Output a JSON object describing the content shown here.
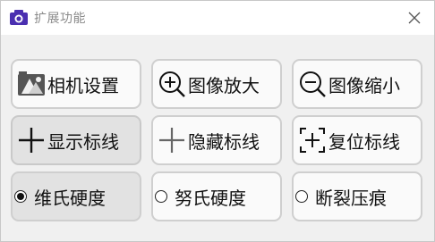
{
  "window": {
    "title": "扩展功能"
  },
  "buttons": {
    "camera_settings": "相机设置",
    "zoom_in": "图像放大",
    "zoom_out": "图像缩小",
    "show_marker": "显示标线",
    "hide_marker": "隐藏标线",
    "reset_marker": "复位标线"
  },
  "hardness_mode": {
    "options": [
      "维氏硬度",
      "努氏硬度",
      "断裂压痕"
    ],
    "selected": "维氏硬度"
  },
  "colors": {
    "app_icon": "#4a2fb0",
    "text": "#111111",
    "button_bg": "#fafafa"
  }
}
